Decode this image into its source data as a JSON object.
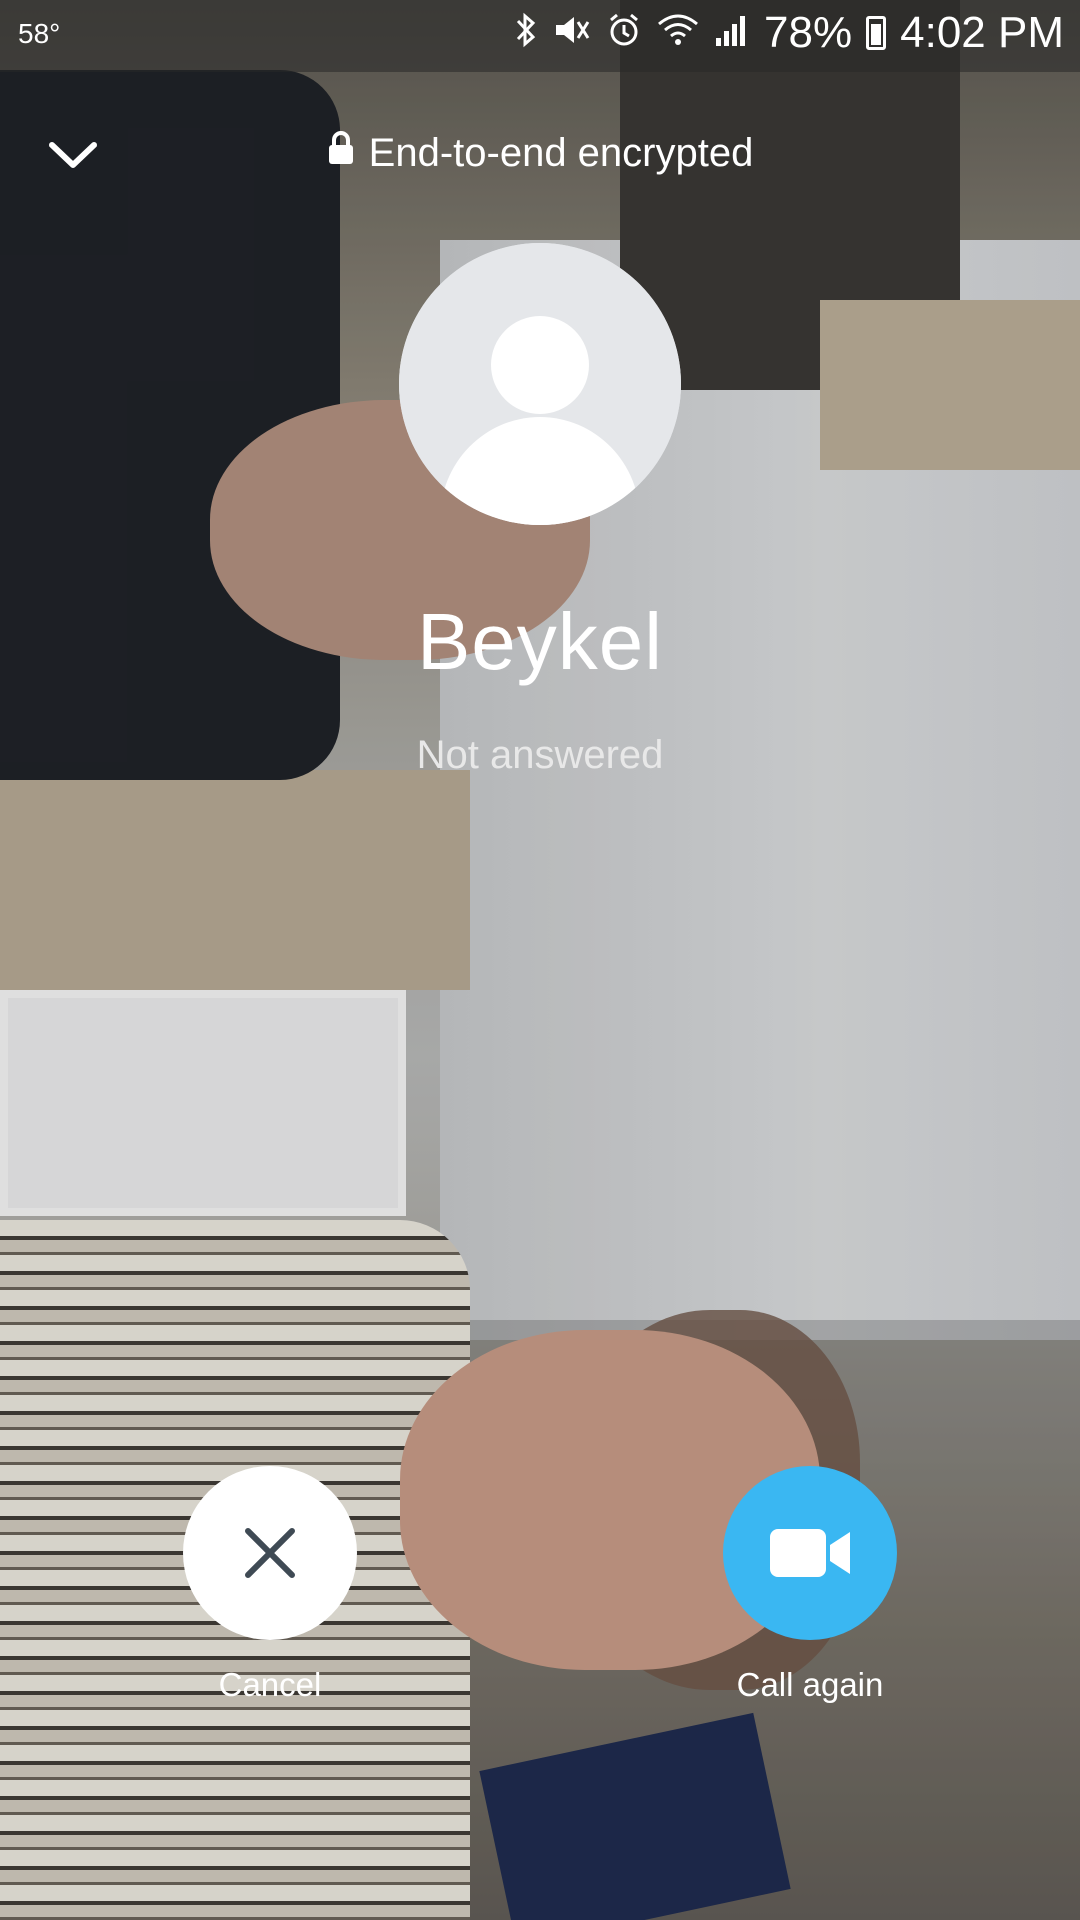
{
  "status_bar": {
    "temperature": "58°",
    "battery_percent": "78%",
    "time": "4:02 PM",
    "icons": [
      "bluetooth-icon",
      "vibrate-mute-icon",
      "alarm-icon",
      "wifi-icon",
      "cell-signal-icon",
      "battery-icon"
    ]
  },
  "header": {
    "collapse_icon": "chevron-down-icon",
    "encryption_label": "End-to-end encrypted"
  },
  "contact": {
    "name": "Beykel",
    "call_status": "Not answered"
  },
  "actions": {
    "cancel_label": "Cancel",
    "call_again_label": "Call again"
  },
  "colors": {
    "call_again_button": "#3ab7f2",
    "cancel_button": "#ffffff",
    "cancel_icon": "#3f4a54"
  }
}
